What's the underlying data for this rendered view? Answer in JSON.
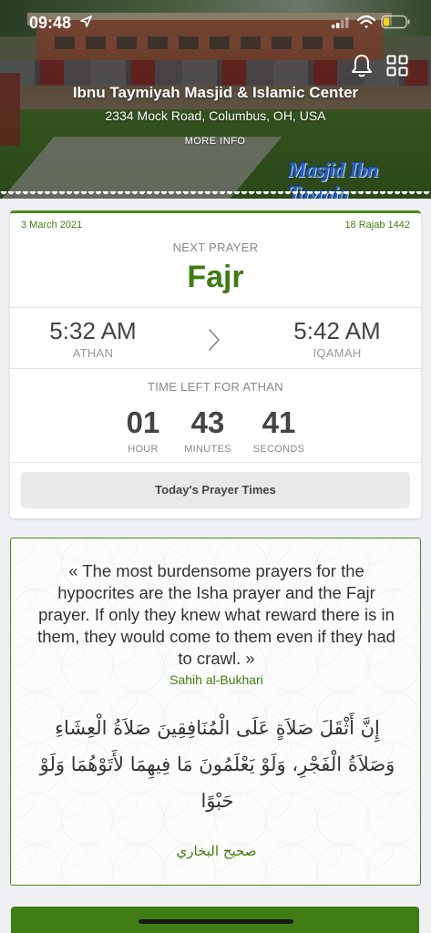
{
  "status": {
    "time": "09:48"
  },
  "masjid": {
    "name": "Ibnu Taymiyah Masjid & Islamic Center",
    "address": "2334 Mock Road, Columbus, OH, USA",
    "more_info": "MORE INFO",
    "watermark": "Masjid Ibn Taymia"
  },
  "prayer": {
    "gregorian_date": "3 March 2021",
    "hijri_date": "18 Rajab 1442",
    "next_label": "NEXT PRAYER",
    "next_name": "Fajr",
    "athan_time": "5:32 AM",
    "athan_label": "ATHAN",
    "iqamah_time": "5:42 AM",
    "iqamah_label": "IQAMAH",
    "time_left_label": "TIME LEFT FOR ATHAN",
    "countdown": {
      "hour": "01",
      "hour_label": "HOUR",
      "minutes": "43",
      "minutes_label": "MINUTES",
      "seconds": "41",
      "seconds_label": "SECONDS"
    },
    "todays_button": "Today's Prayer Times"
  },
  "hadith": {
    "text": "« The most burdensome prayers for the hypocrites are the Isha prayer and the Fajr prayer. If only they knew what reward there is in them, they would come to them even if they had to crawl. »",
    "source": "Sahih al-Bukhari",
    "arabic": "إِنَّ أَثْقَلَ صَلاَةٍ عَلَى الْمُنَافِقِينَ صَلاَةُ الْعِشَاءِ وَصَلاَةُ الْفَجْرِ، وَلَوْ يَعْلَمُونَ مَا فِيهِمَا لأَتَوْهُمَا وَلَوْ حَبْوًا",
    "arabic_source": "صحيح البخاري"
  },
  "colors": {
    "accent": "#3f7d14",
    "card": "#ffffff",
    "background": "#eef0f3"
  },
  "icons": [
    "location-arrow-icon",
    "signal-icon",
    "wifi-icon",
    "battery-icon",
    "bell-icon",
    "grid-icon",
    "chevron-right-icon"
  ]
}
